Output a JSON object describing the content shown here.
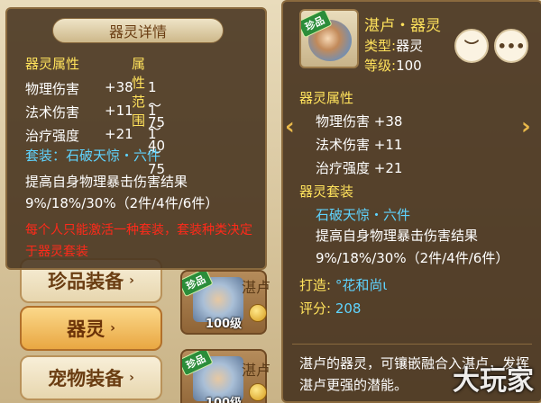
{
  "left_menu": {
    "items": [
      {
        "label": "珍品装备",
        "active": false
      },
      {
        "label": "器灵",
        "active": true
      },
      {
        "label": "宠物装备",
        "active": false
      }
    ],
    "arrow": "›"
  },
  "list_cards": [
    {
      "badge": "珍品",
      "level": "100级",
      "name": "湛卢"
    },
    {
      "badge": "珍品",
      "level": "100级",
      "name": "湛卢"
    }
  ],
  "left_popup": {
    "title": "器灵详情",
    "header_attr": "器灵属性",
    "header_range": "属性范围",
    "rows": [
      {
        "name": "物理伤害",
        "value": "+38",
        "range": "1～75"
      },
      {
        "name": "法术伤害",
        "value": "+11",
        "range": "1～40"
      },
      {
        "name": "治疗强度",
        "value": "+21",
        "range": "1～75"
      }
    ],
    "set_label": "套装：石破天惊・六件",
    "set_desc": "提高自身物理暴击伤害结果9%/18%/30%（2件/4件/6件）",
    "warning": "每个人只能激活一种套装，套装种类决定于器灵套装"
  },
  "right_popup": {
    "badge": "珍品",
    "name": "湛卢・器灵",
    "type_label": "类型:",
    "type_value": "器灵",
    "level_label": "等级:",
    "level_value": "100",
    "attr_header": "器灵属性",
    "attrs": [
      "物理伤害 +38",
      "法术伤害 +11",
      "治疗强度 +21"
    ],
    "set_header": "器灵套装",
    "set_name": "石破天惊・六件",
    "set_desc": "提高自身物理暴击伤害结果9%/18%/30%（2件/4件/6件）",
    "forge_label": "打造:",
    "forge_value": "°花和尚ι",
    "score_label": "评分:",
    "score_value": "208",
    "footer": "湛卢的器灵，可镶嵌融合入湛卢，发挥湛卢更强的潜能。",
    "eye_icon": "eye-closed-icon",
    "more_icon": "more-icon",
    "more_glyph": "•••",
    "eye_glyph": "︶"
  },
  "nav": {
    "left": "‹",
    "right": "›"
  },
  "watermark": "大玩家",
  "colors": {
    "gold_text": "#ffe25c",
    "cyan_text": "#5fd4ff",
    "warn_text": "#ff2a1a",
    "panel_bg": "#46321e"
  }
}
